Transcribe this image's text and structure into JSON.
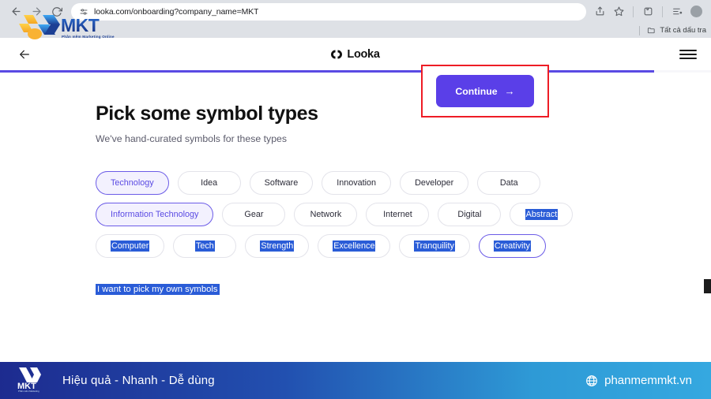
{
  "browser": {
    "back_icon": "arrow-left-icon",
    "forward_icon": "arrow-right-icon",
    "reload_icon": "reload-icon",
    "site_settings_icon": "tune-icon",
    "url_prefix": "looka.com",
    "url_rest": "/onboarding?company_name=",
    "url_suffix": "MKT",
    "url_full": "looka.com/onboarding?company_name=MKT",
    "share_icon": "share-icon",
    "bookmark_icon": "star-icon",
    "extensions_icon": "puzzle-icon",
    "split_icon": "reading-list-icon",
    "profile_icon": "avatar-icon",
    "bookmarks_folder_icon": "folder-icon",
    "bookmarks_label": "Tất cả dấu tra"
  },
  "overlay": {
    "logo_name": "mkt-logo-watermark",
    "logo_text": "MKT",
    "logo_tagline": "Phần mềm Marketing Online"
  },
  "header": {
    "back_icon": "arrow-left-icon",
    "brand_mark": "looka-mark-icon",
    "brand_name": "Looka",
    "menu_icon": "hamburger-menu-icon"
  },
  "progress": {
    "percent": 92,
    "color": "#5a4ae3"
  },
  "main": {
    "title": "Pick some symbol types",
    "subtitle": "We've hand-curated symbols for these types",
    "continue_label": "Continue",
    "continue_arrow": "→",
    "continue_color": "#5a3fe8",
    "annotation_color": "#ee1c25",
    "own_symbols_label": "I want to pick my own symbols",
    "own_symbols_highlighted": true,
    "chip_rows": [
      [
        {
          "label": "Technology",
          "selected": true,
          "highlighted": false
        },
        {
          "label": "Idea",
          "selected": false,
          "highlighted": false
        },
        {
          "label": "Software",
          "selected": false,
          "highlighted": false
        },
        {
          "label": "Innovation",
          "selected": false,
          "highlighted": false
        },
        {
          "label": "Developer",
          "selected": false,
          "highlighted": false
        },
        {
          "label": "Data",
          "selected": false,
          "highlighted": false
        }
      ],
      [
        {
          "label": "Information Technology",
          "selected": true,
          "highlighted": false
        },
        {
          "label": "Gear",
          "selected": false,
          "highlighted": false
        },
        {
          "label": "Network",
          "selected": false,
          "highlighted": false
        },
        {
          "label": "Internet",
          "selected": false,
          "highlighted": false
        },
        {
          "label": "Digital",
          "selected": false,
          "highlighted": false
        },
        {
          "label": "Abstract",
          "selected": false,
          "highlighted": true
        }
      ],
      [
        {
          "label": "Computer",
          "selected": false,
          "highlighted": true
        },
        {
          "label": "Tech",
          "selected": false,
          "highlighted": true
        },
        {
          "label": "Strength",
          "selected": false,
          "highlighted": true
        },
        {
          "label": "Excellence",
          "selected": false,
          "highlighted": true
        },
        {
          "label": "Tranquility",
          "selected": false,
          "highlighted": true
        },
        {
          "label": "Creativity",
          "selected": true,
          "highlighted": true
        }
      ]
    ]
  },
  "banner": {
    "logo_name": "mkt-logo-banner",
    "logo_text": "MKT",
    "slogan": "Hiệu quả - Nhanh  - Dễ dùng",
    "globe_icon": "globe-icon",
    "website": "phanmemmkt.vn"
  }
}
